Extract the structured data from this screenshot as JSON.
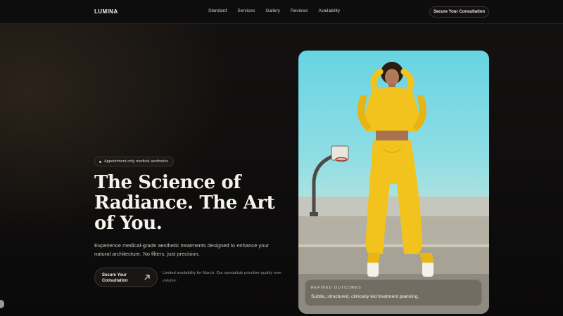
{
  "brand": {
    "name": "LUMINA"
  },
  "nav": {
    "links": [
      "Standard",
      "Services",
      "Gallery",
      "Reviews",
      "Availability"
    ],
    "cta_label": "Secure Your Consultation"
  },
  "hero": {
    "badge": "Appointment-only medical aesthetics",
    "headline_lines": [
      "The Science of",
      "Radiance. The Art",
      "of You."
    ],
    "subtext": "Experience medical-grade aesthetic treatments designed to enhance your natural architecture. No filters, just precision.",
    "cta_label_line1": "Secure Your",
    "cta_label_line2": "Consultation",
    "note": "Limited availability for March. Our specialists prioritize quality over volume."
  },
  "image_card": {
    "eyebrow": "REFINED OUTCOMES",
    "text": "Subtle, structured, clinically led treatment planning."
  },
  "icons": {
    "cta_arrow": "arrow-up-right-icon",
    "badge_dot": "dot-icon"
  },
  "colors": {
    "background": "#0c0b0b",
    "accent_yellow": "#f2c31c",
    "sky": "#66d4e2"
  }
}
